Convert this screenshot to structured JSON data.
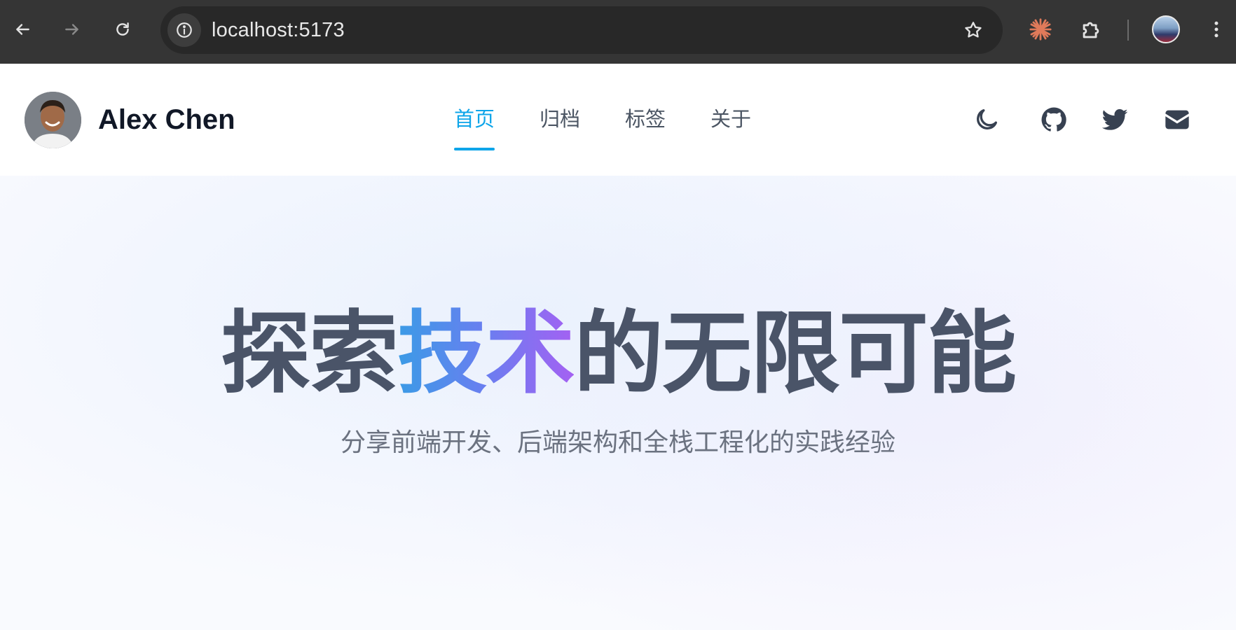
{
  "browser": {
    "url": "localhost:5173",
    "icons": {
      "back": "arrow-left-icon",
      "forward": "arrow-right-icon",
      "reload": "reload-icon",
      "site_info": "info-icon",
      "bookmark": "star-icon",
      "extension": "claude-extension-icon",
      "extensions_menu": "puzzle-icon",
      "menu": "kebab-menu-icon"
    }
  },
  "header": {
    "author_name": "Alex Chen",
    "nav": [
      {
        "label": "首页",
        "active": true
      },
      {
        "label": "归档",
        "active": false
      },
      {
        "label": "标签",
        "active": false
      },
      {
        "label": "关于",
        "active": false
      }
    ],
    "icons": [
      "moon-icon",
      "github-icon",
      "twitter-icon",
      "mail-icon"
    ]
  },
  "hero": {
    "title_prefix": "探索",
    "title_highlight": "技术",
    "title_suffix": "的无限可能",
    "subtitle": "分享前端开发、后端架构和全栈工程化的实践经验"
  },
  "colors": {
    "accent": "#0ea5e9",
    "gradient_start": "#3b9be6",
    "gradient_end": "#a461f2",
    "title": "#4a5468",
    "chrome_bg": "#353535"
  }
}
